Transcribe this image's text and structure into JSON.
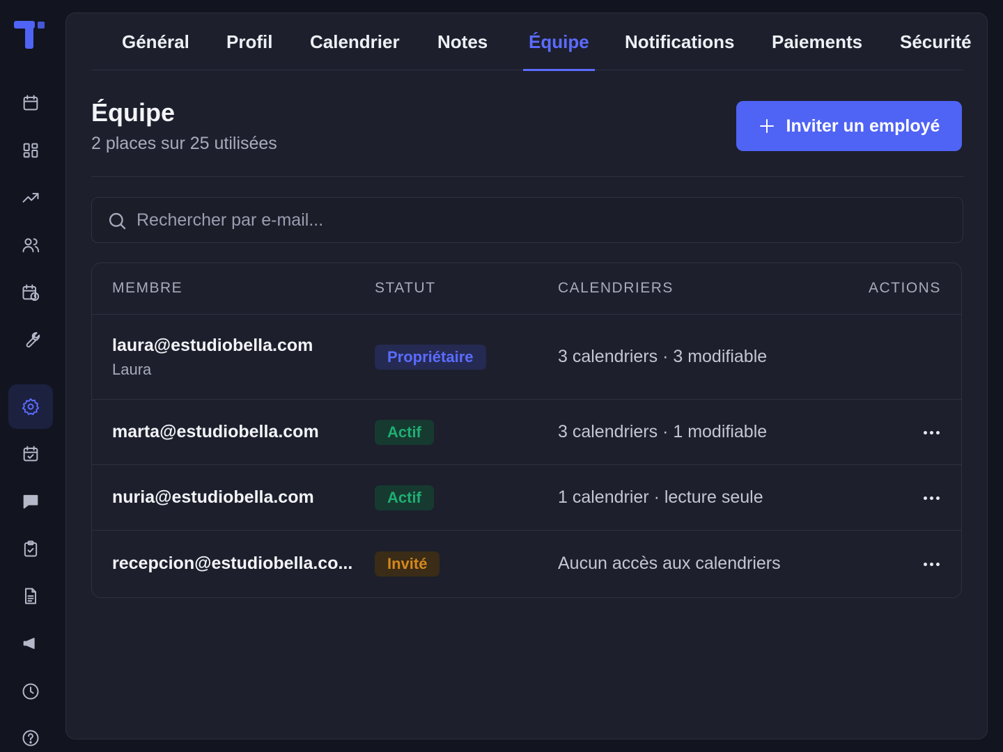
{
  "app": {
    "logo": "app-logo"
  },
  "sidebar": {
    "items": [
      {
        "icon": "calendar-icon",
        "active": false
      },
      {
        "icon": "dashboard-icon",
        "active": false
      },
      {
        "icon": "trending-up-icon",
        "active": false
      },
      {
        "icon": "users-icon",
        "active": false
      },
      {
        "icon": "calendar-clock-icon",
        "active": false
      },
      {
        "icon": "wrench-icon",
        "active": false
      },
      {
        "icon": "settings-icon",
        "active": true
      },
      {
        "icon": "calendar-check-icon",
        "active": false
      },
      {
        "icon": "chat-icon",
        "active": false
      },
      {
        "icon": "clipboard-check-icon",
        "active": false
      },
      {
        "icon": "document-icon",
        "active": false
      },
      {
        "icon": "megaphone-icon",
        "active": false
      },
      {
        "icon": "clock-icon",
        "active": false
      },
      {
        "icon": "help-icon",
        "active": false
      }
    ]
  },
  "tabs": [
    {
      "label": "Général",
      "active": false
    },
    {
      "label": "Profil",
      "active": false
    },
    {
      "label": "Calendrier",
      "active": false
    },
    {
      "label": "Notes",
      "active": false
    },
    {
      "label": "Équipe",
      "active": true
    },
    {
      "label": "Notifications",
      "active": false
    },
    {
      "label": "Paiements",
      "active": false
    },
    {
      "label": "Sécurité",
      "active": false
    }
  ],
  "header": {
    "title": "Équipe",
    "subtitle": "2 places sur 25 utilisées",
    "invite_label": "Inviter un employé"
  },
  "search": {
    "placeholder": "Rechercher par e-mail...",
    "value": ""
  },
  "table": {
    "columns": [
      "MEMBRE",
      "STATUT",
      "CALENDRIERS",
      "ACTIONS"
    ],
    "rows": [
      {
        "email": "laura@estudiobella.com",
        "name": "Laura",
        "status": "Propriétaire",
        "status_kind": "owner",
        "calendars": "3 calendriers · 3 modifiable",
        "has_actions": false
      },
      {
        "email": "marta@estudiobella.com",
        "name": "",
        "status": "Actif",
        "status_kind": "active",
        "calendars": "3 calendriers · 1 modifiable",
        "has_actions": true
      },
      {
        "email": "nuria@estudiobella.com",
        "name": "",
        "status": "Actif",
        "status_kind": "active",
        "calendars": "1 calendrier · lecture seule",
        "has_actions": true
      },
      {
        "email": "recepcion@estudiobella.co...",
        "name": "",
        "status": "Invité",
        "status_kind": "invited",
        "calendars": "Aucun accès aux calendriers",
        "has_actions": true
      }
    ]
  },
  "colors": {
    "accent": "#4f63f5",
    "owner_bg": "#252a52",
    "owner_fg": "#5b6cff",
    "active_bg": "#163a30",
    "active_fg": "#1fae74",
    "invited_bg": "#3a2c16",
    "invited_fg": "#d6871c"
  }
}
